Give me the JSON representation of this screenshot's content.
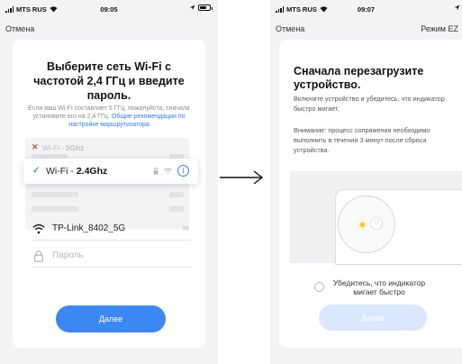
{
  "left_screen": {
    "status": {
      "carrier": "MTS RUS",
      "time": "09:05"
    },
    "nav": {
      "cancel": "Отмена"
    },
    "title": "Выберите сеть Wi-Fi с частотой 2,4 ГГц и введите пароль.",
    "hint": {
      "text": "Если ваш Wi-Fi составляет 5 ГГц, пожалуйста, сначала установите его на 2,4 ГГц.",
      "link": "Общие рекомендации по настройке маршрутизатора"
    },
    "network_5g": {
      "prefix": "Wi-Fi - ",
      "band": "5Ghz"
    },
    "network_24": {
      "prefix": "Wi-Fi - ",
      "band": "2.4Ghz"
    },
    "ssid_value": "TP-Link_8402_5G",
    "password_placeholder": "Пароль",
    "next_button": "Далее"
  },
  "right_screen": {
    "status": {
      "carrier": "MTS RUS",
      "time": "09:07"
    },
    "nav": {
      "cancel": "Отмена",
      "mode": "Режим EZ"
    },
    "title": "Сначала перезагрузите устройство.",
    "instruction": "Включите устройство и убедитесь, что индикатор быстро мигает.",
    "note": "Внимание: процесс сопряжения необходимо выполнить в течении 3 минут после сброса устройства.",
    "confirm": "Убедитесь, что индикатор мигает быстро",
    "next_button": "Далее"
  },
  "colors": {
    "accent": "#3c88f2",
    "link": "#2f7df6",
    "check": "#37b36a",
    "error": "#e04848",
    "indicator": "#f5c518",
    "button_disabled": "#dbe8fb"
  },
  "icons": {
    "wifi": "wifi-icon",
    "lock": "lock-icon",
    "info": "info-icon",
    "arrow": "arrow-right-icon"
  }
}
